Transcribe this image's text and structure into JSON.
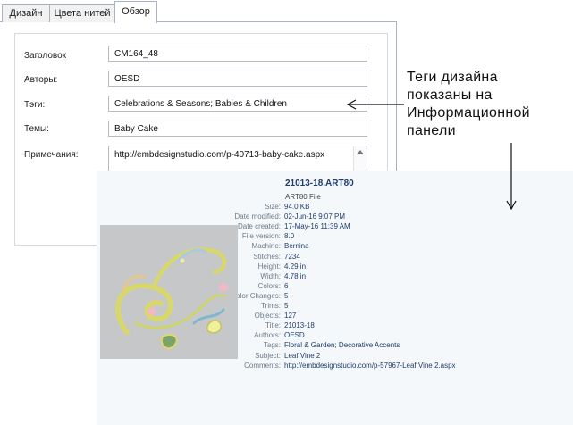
{
  "dialog": {
    "tabs": [
      "Дизайн",
      "Цвета нитей",
      "Обзор"
    ],
    "active_tab": "Обзор",
    "fields": {
      "title": {
        "label": "Заголовок",
        "value": "CM164_48"
      },
      "authors": {
        "label": "Авторы:",
        "value": "OESD"
      },
      "tags": {
        "label": "Тэги:",
        "value": "Celebrations & Seasons; Babies & Children"
      },
      "subject": {
        "label": "Темы:",
        "value": "Baby Cake"
      },
      "notes": {
        "label": "Примечания:",
        "value": "http://embdesignstudio.com/p-40713-baby-cake.aspx"
      }
    }
  },
  "info_panel": {
    "filename": "21013-18.ART80",
    "filetype": "ART80 File",
    "properties": [
      {
        "key": "Size:",
        "value": "94.0 KB"
      },
      {
        "key": "Date modified:",
        "value": "02-Jun-16 9:07 PM"
      },
      {
        "key": "Date created:",
        "value": "17-May-16 11:39 AM"
      },
      {
        "key": "File version:",
        "value": "8.0"
      },
      {
        "key": "Machine:",
        "value": "Bernina"
      },
      {
        "key": "Stitches:",
        "value": "7234"
      },
      {
        "key": "Height:",
        "value": "4.29 in"
      },
      {
        "key": "Width:",
        "value": "4.78 in"
      },
      {
        "key": "Colors:",
        "value": "6"
      },
      {
        "key": "Color Changes:",
        "value": "5"
      },
      {
        "key": "Trims:",
        "value": "5"
      },
      {
        "key": "Objects:",
        "value": "127"
      },
      {
        "key": "Title:",
        "value": "21013-18"
      },
      {
        "key": "Authors:",
        "value": "OESD"
      },
      {
        "key": "Tags:",
        "value": "Floral & Garden; Decorative Accents"
      },
      {
        "key": "Subject:",
        "value": "Leaf Vine 2"
      },
      {
        "key": "Comments:",
        "value": "http://embdesignstudio.com/p-57967-Leaf Vine 2.aspx"
      }
    ]
  },
  "callout": {
    "lines": [
      "Теги дизайна",
      "показаны на",
      "Информационной",
      "панели"
    ]
  }
}
